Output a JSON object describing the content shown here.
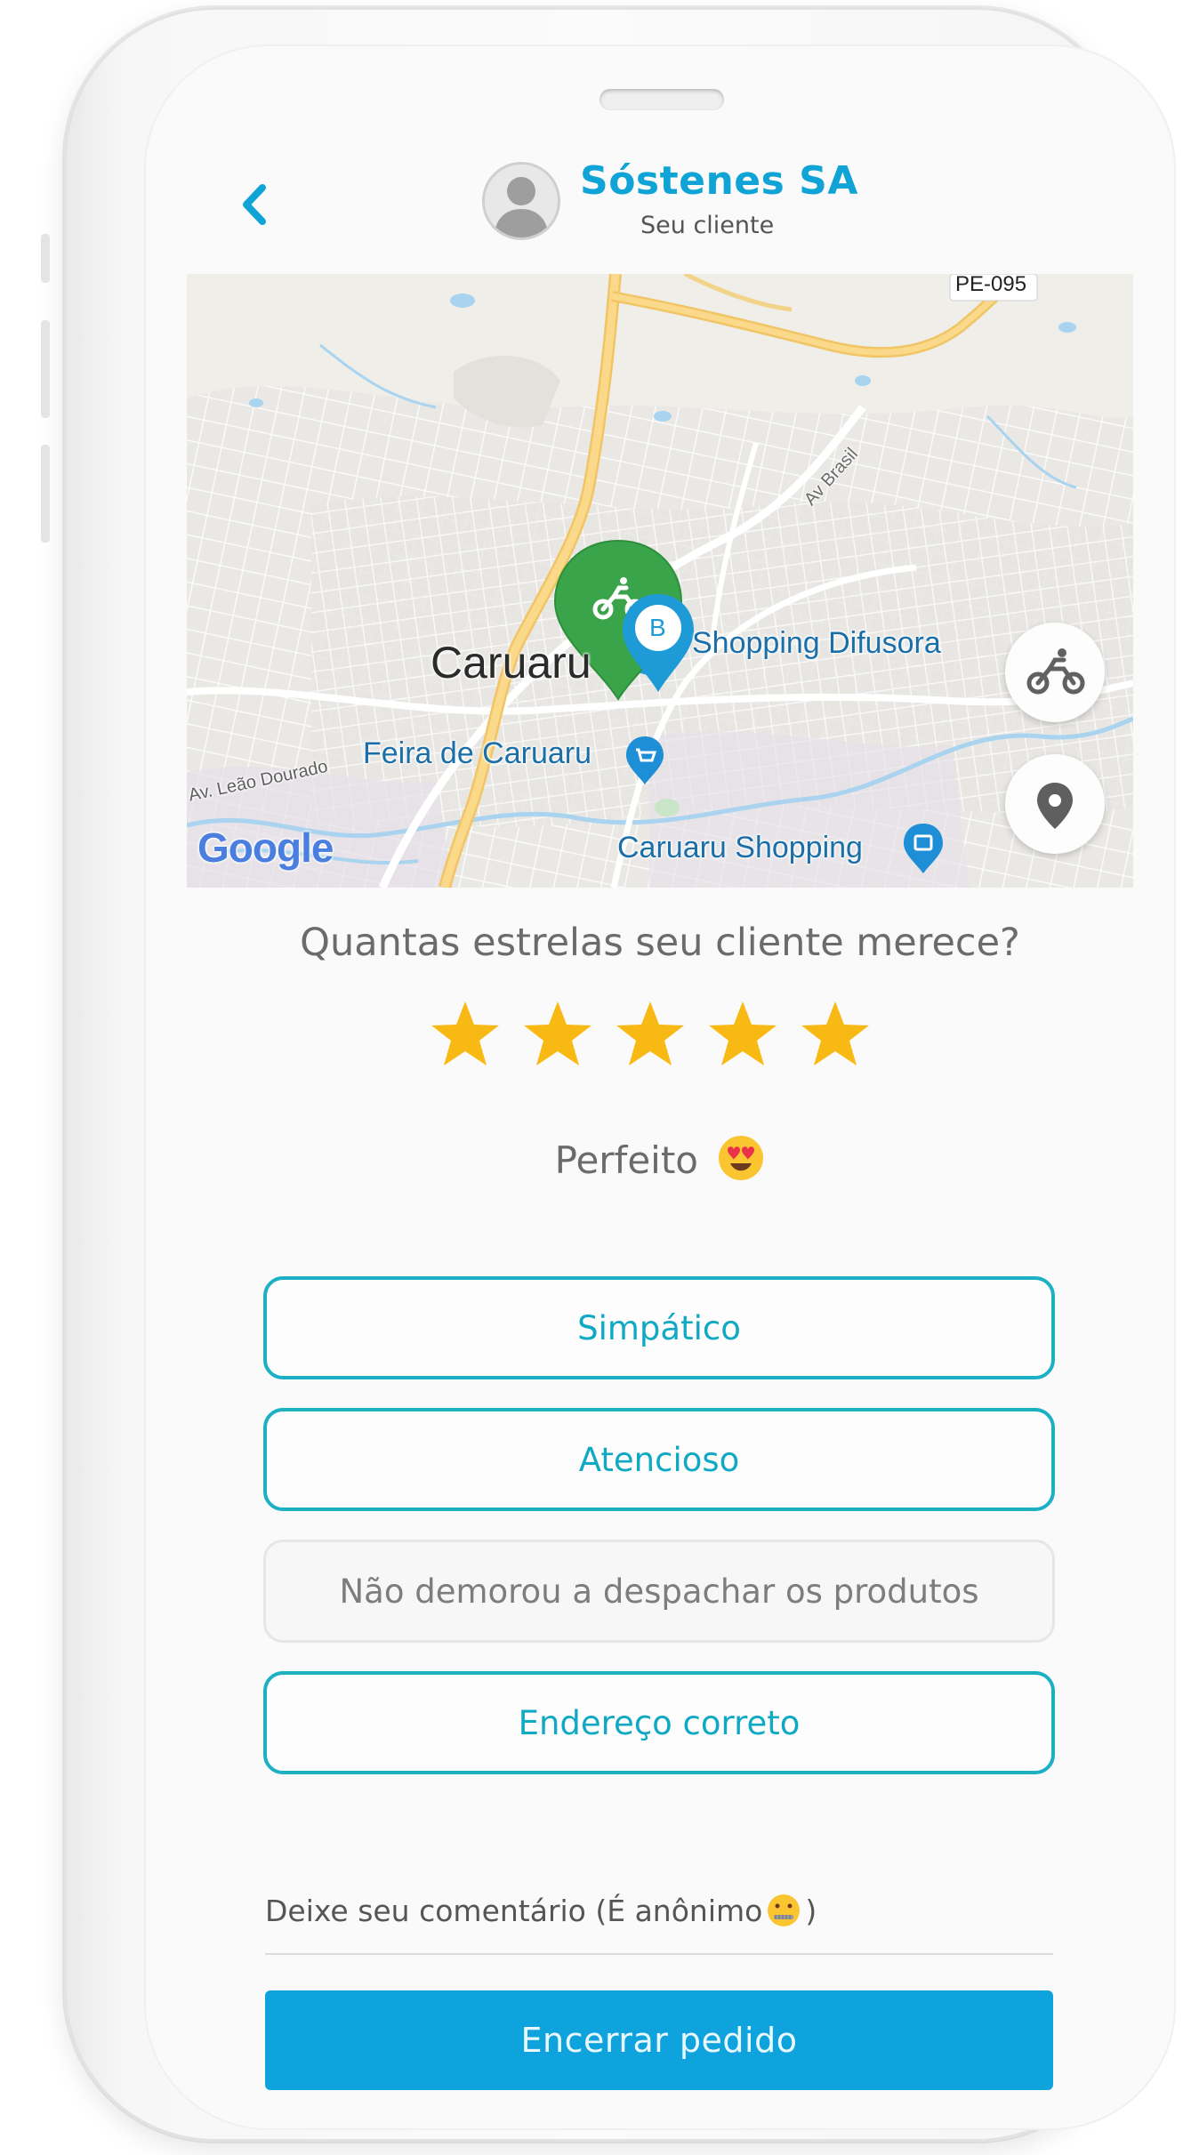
{
  "header": {
    "title": "Sóstenes SA",
    "subtitle": "Seu cliente"
  },
  "map": {
    "labels": {
      "city": "Caruaru",
      "shopping_difusora": "Shopping Difusora",
      "feira": "Feira de Caruaru",
      "caruaru_shopping": "Caruaru Shopping",
      "av_leao": "Av. Leão Dourado",
      "av_brasil": "Av Brasil",
      "pe095": "PE-095",
      "google": "Google",
      "marker_b": "B"
    }
  },
  "rating": {
    "question": "Quantas estrelas seu cliente merece?",
    "stars": 5,
    "max_stars": 5,
    "verdict": "Perfeito"
  },
  "tags": [
    {
      "label": "Simpático",
      "selected": true
    },
    {
      "label": "Atencioso",
      "selected": true
    },
    {
      "label": "Não demorou a despachar os produtos",
      "selected": false
    },
    {
      "label": "Endereço correto",
      "selected": true
    }
  ],
  "comment": {
    "placeholder_before": "Deixe seu comentário (É anônimo",
    "placeholder_after": ")"
  },
  "primary_button": "Encerrar pedido",
  "colors": {
    "accent": "#10a4d6",
    "tag_border": "#1bb0c4",
    "button": "#0ea3dd",
    "star": "#f9b914",
    "marker_green": "#3aa44a",
    "marker_blue": "#1e9bd7"
  },
  "icons": {
    "back": "chevron-left-icon",
    "avatar": "user-silhouette-icon",
    "motorcycle": "motorcycle-icon",
    "location": "map-pin-icon",
    "shopping": "shopping-bag-icon",
    "cart": "cart-icon"
  }
}
